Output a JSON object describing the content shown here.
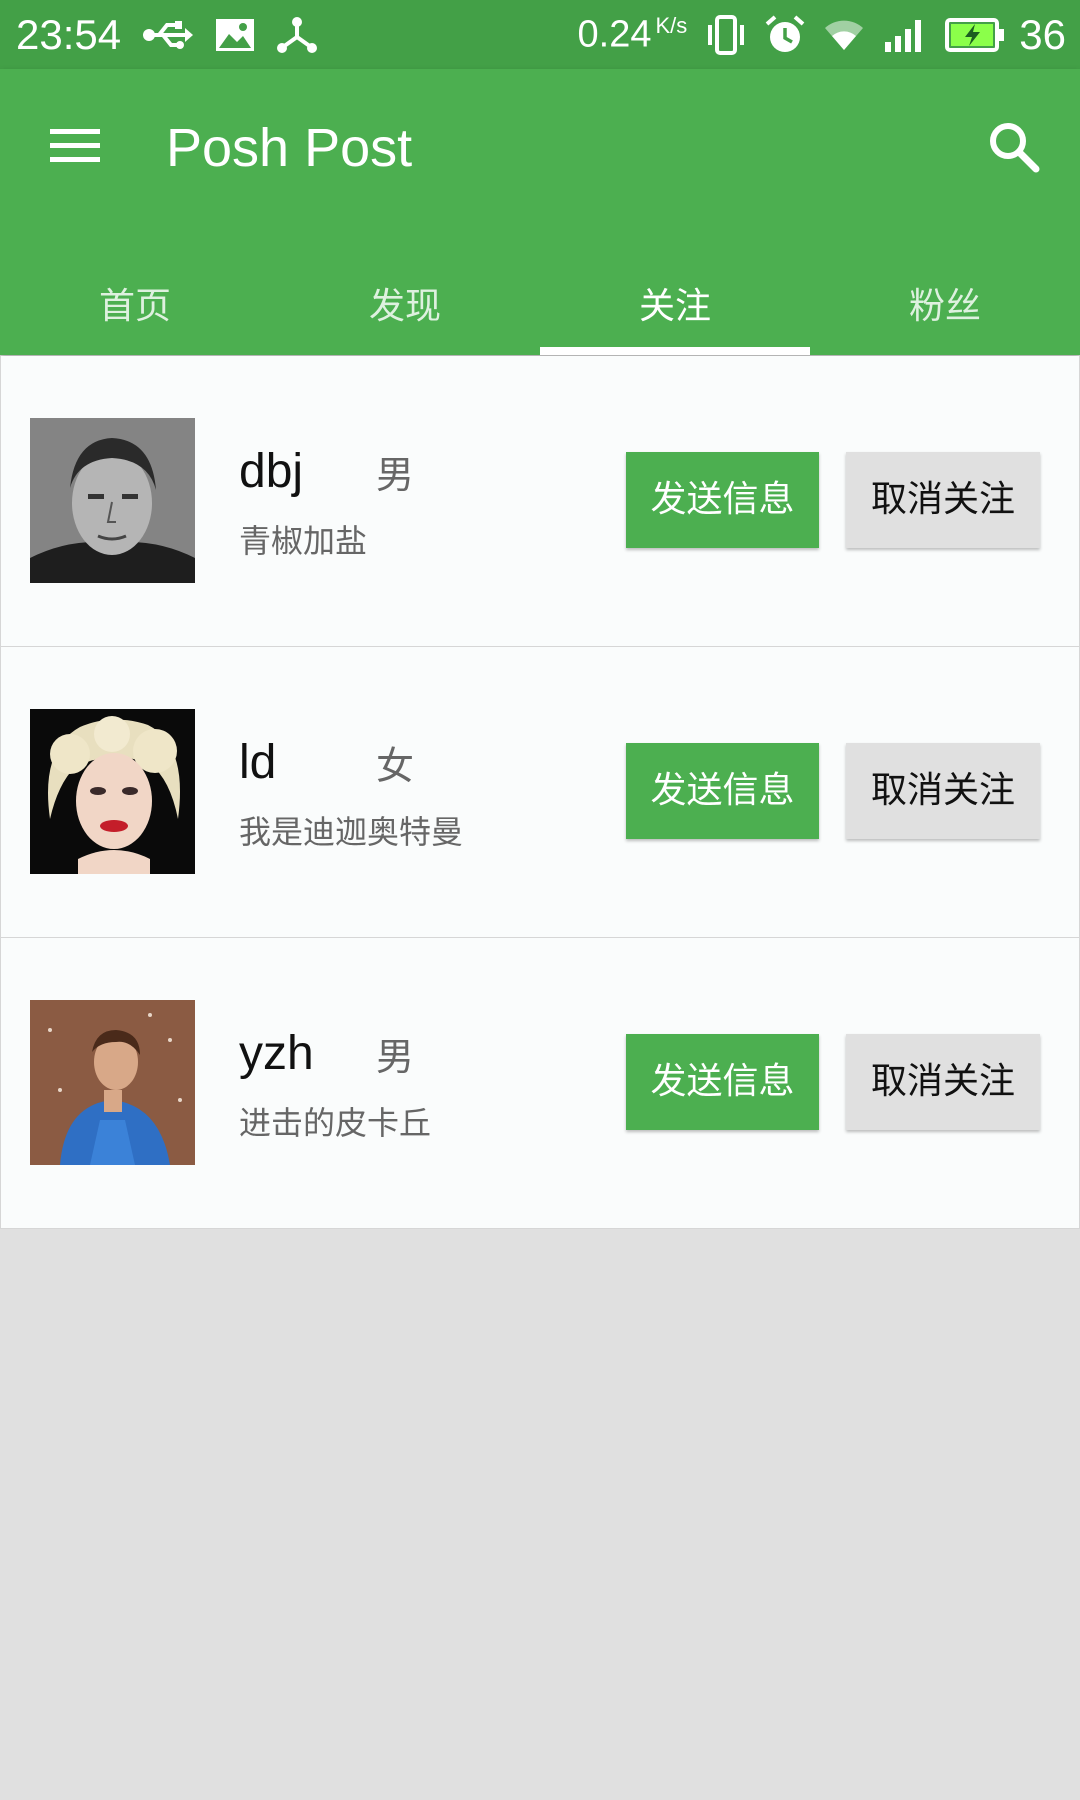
{
  "status_bar": {
    "time": "23:54",
    "net_speed": "0.24",
    "net_unit": "K/s",
    "battery": "36",
    "icons": [
      "usb-icon",
      "image-icon",
      "share-icon",
      "vibrate-icon",
      "alarm-icon",
      "wifi-icon",
      "signal-icon",
      "battery-charging-icon"
    ]
  },
  "appbar": {
    "title": "Posh Post",
    "menu_icon": "menu-icon",
    "search_icon": "search-icon"
  },
  "tabs": [
    {
      "label": "首页",
      "active": false
    },
    {
      "label": "发现",
      "active": false
    },
    {
      "label": "关注",
      "active": true
    },
    {
      "label": "粉丝",
      "active": false
    }
  ],
  "users": [
    {
      "name": "dbj",
      "gender": "男",
      "signature": "青椒加盐",
      "send_label": "发送信息",
      "unfollow_label": "取消关注"
    },
    {
      "name": "ld",
      "gender": "女",
      "signature": "我是迪迦奥特曼",
      "send_label": "发送信息",
      "unfollow_label": "取消关注"
    },
    {
      "name": "yzh",
      "gender": "男",
      "signature": "进击的皮卡丘",
      "send_label": "发送信息",
      "unfollow_label": "取消关注"
    }
  ],
  "colors": {
    "primary": "#4caf50",
    "status_bar": "#43a047",
    "list_bg": "#fafcfc",
    "page_bg": "#e0e0e0",
    "secondary_button": "#e0e0e0"
  }
}
